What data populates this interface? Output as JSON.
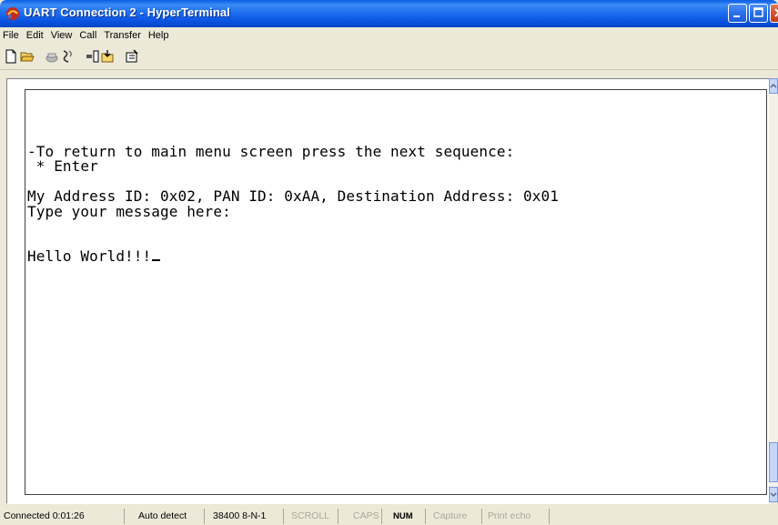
{
  "window": {
    "title": "UART Connection 2 - HyperTerminal",
    "app_icon": "hyperterminal-icon",
    "controls": [
      "minimize-icon",
      "maximize-icon",
      "close-icon"
    ]
  },
  "menu": [
    "File",
    "Edit",
    "View",
    "Call",
    "Transfer",
    "Help"
  ],
  "toolbar": [
    "new-connection-icon",
    "open-icon",
    "disconnect-icon",
    "connect-icon",
    "send-file-icon",
    "receive-file-icon",
    "properties-icon"
  ],
  "terminal": {
    "lines": [
      "",
      "-To return to main menu screen press the next sequence:",
      " * Enter",
      "",
      "My Address ID: 0x02, PAN ID: 0xAA, Destination Address: 0x01",
      "Type your message here:",
      "",
      "",
      "Hello World!!!"
    ]
  },
  "status": {
    "connection": "Connected 0:01:26",
    "detect": "Auto detect",
    "settings": "38400 8-N-1",
    "scroll": "SCROLL",
    "caps": "CAPS",
    "num": "NUM",
    "capture": "Capture",
    "print_echo": "Print echo"
  },
  "colors": {
    "titlebar": "#0a5ee6",
    "close_button": "#d4512f",
    "terminal_bg": "#ffffff",
    "terminal_text": "#000000",
    "disabled_text": "#aca899"
  }
}
